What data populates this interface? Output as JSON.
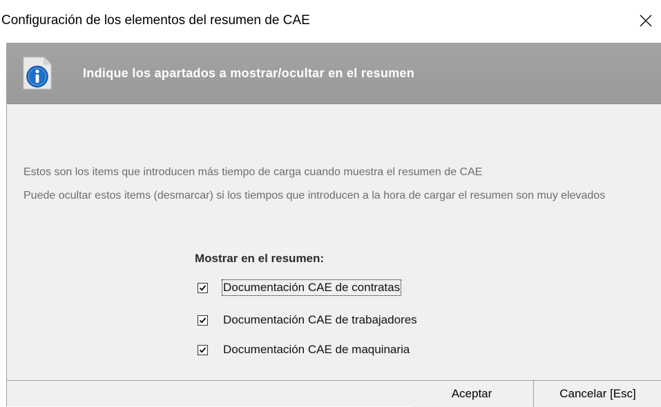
{
  "window": {
    "title": "Configuración de los elementos del resumen de CAE"
  },
  "header": {
    "text": "Indique los apartados a mostrar/ocultar en el resumen"
  },
  "description": {
    "line1": "Estos son los items que introducen más tiempo de carga cuando muestra el resumen de CAE",
    "line2": "Puede ocultar estos items (desmarcar) si los tiempos que introducen a la hora de cargar el resumen son muy elevados"
  },
  "group": {
    "title": "Mostrar en el resumen:",
    "items": [
      {
        "label": "Documentación CAE de contratas",
        "checked": true,
        "focused": true
      },
      {
        "label": "Documentación CAE de trabajadores",
        "checked": true,
        "focused": false
      },
      {
        "label": "Documentación CAE de maquinaria",
        "checked": true,
        "focused": false
      }
    ]
  },
  "buttons": {
    "ok": "Aceptar",
    "cancel": "Cancelar [Esc]"
  },
  "icons": {
    "close": "close-icon",
    "info": "info-icon",
    "check": "checkmark-icon"
  },
  "colors": {
    "header_band": "#9f9f9f",
    "info_icon_blue": "#1f6fc4",
    "description_text": "#6d6d6d"
  }
}
